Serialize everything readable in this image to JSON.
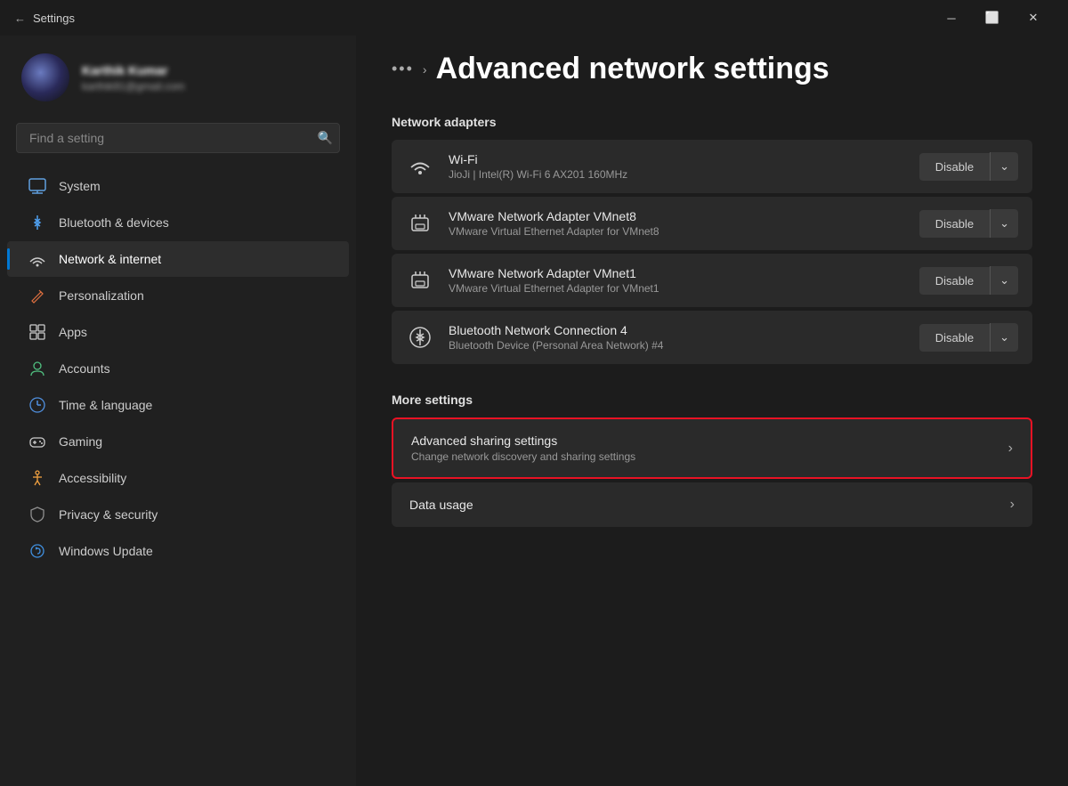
{
  "titlebar": {
    "title": "Settings",
    "min_label": "─",
    "max_label": "⬜",
    "close_label": "✕"
  },
  "user": {
    "name": "Karthik Kumar",
    "email": "karthik91@gmail.com",
    "avatar_alt": "User avatar"
  },
  "search": {
    "placeholder": "Find a setting"
  },
  "nav": {
    "items": [
      {
        "id": "system",
        "label": "System",
        "icon": "🖥",
        "active": false
      },
      {
        "id": "bluetooth",
        "label": "Bluetooth & devices",
        "icon": "⬡",
        "active": false
      },
      {
        "id": "network",
        "label": "Network & internet",
        "icon": "📶",
        "active": true
      },
      {
        "id": "personalization",
        "label": "Personalization",
        "icon": "✏",
        "active": false
      },
      {
        "id": "apps",
        "label": "Apps",
        "icon": "🧩",
        "active": false
      },
      {
        "id": "accounts",
        "label": "Accounts",
        "icon": "👤",
        "active": false
      },
      {
        "id": "time",
        "label": "Time & language",
        "icon": "🕐",
        "active": false
      },
      {
        "id": "gaming",
        "label": "Gaming",
        "icon": "🎮",
        "active": false
      },
      {
        "id": "accessibility",
        "label": "Accessibility",
        "icon": "♿",
        "active": false
      },
      {
        "id": "privacy",
        "label": "Privacy & security",
        "icon": "🛡",
        "active": false
      },
      {
        "id": "update",
        "label": "Windows Update",
        "icon": "🔄",
        "active": false
      }
    ]
  },
  "content": {
    "breadcrumb_dots": "•••",
    "breadcrumb_arrow": "›",
    "page_title": "Advanced network settings",
    "network_adapters_label": "Network adapters",
    "adapters": [
      {
        "name": "Wi-Fi",
        "desc": "JioJi | Intel(R) Wi-Fi 6 AX201 160MHz",
        "icon": "wifi",
        "disable_label": "Disable"
      },
      {
        "name": "VMware Network Adapter VMnet8",
        "desc": "VMware Virtual Ethernet Adapter for VMnet8",
        "icon": "ethernet",
        "disable_label": "Disable"
      },
      {
        "name": "VMware Network Adapter VMnet1",
        "desc": "VMware Virtual Ethernet Adapter for VMnet1",
        "icon": "ethernet",
        "disable_label": "Disable"
      },
      {
        "name": "Bluetooth Network Connection 4",
        "desc": "Bluetooth Device (Personal Area Network) #4",
        "icon": "bluetooth-net",
        "disable_label": "Disable"
      }
    ],
    "more_settings_label": "More settings",
    "more_settings": [
      {
        "title": "Advanced sharing settings",
        "desc": "Change network discovery and sharing settings",
        "highlighted": true
      },
      {
        "title": "Data usage",
        "desc": "",
        "highlighted": false
      }
    ]
  }
}
